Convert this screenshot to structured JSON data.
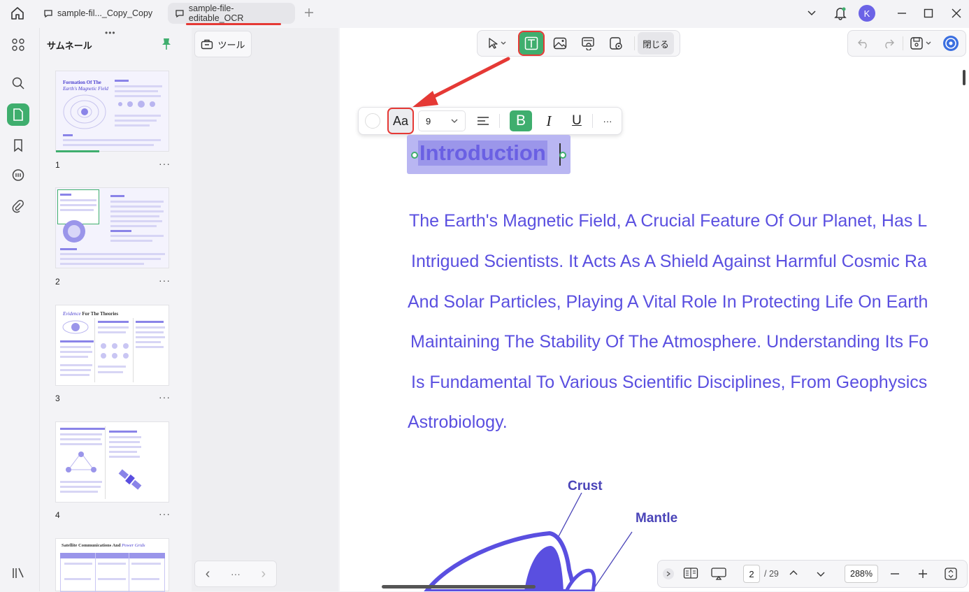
{
  "tabs": [
    {
      "label": "sample-fil..._Copy_Copy"
    },
    {
      "label": "sample-file-editable_OCR"
    }
  ],
  "user": {
    "initial": "K"
  },
  "thumbnails": {
    "title": "サムネール",
    "pages": [
      "1",
      "2",
      "3",
      "4"
    ],
    "more": "···"
  },
  "thumb_text": {
    "p1_title_a": "Formation Of The",
    "p1_title_b": "Earth's Magnetic Field",
    "p3_title_a": "Evidence",
    "p3_title_b": "For The Theories",
    "p5_title_a": "Satellite Communications And",
    "p5_title_b": "Power Grids"
  },
  "tools": {
    "label": "ツール"
  },
  "edit_toolbar": {
    "close_label": "閉じる"
  },
  "format_toolbar": {
    "font_label": "Aa",
    "font_size": "9",
    "bold": "B",
    "italic": "I",
    "underline": "U",
    "more": "···"
  },
  "document": {
    "heading": "Introduction",
    "lines": [
      "The Earth's Magnetic Field, A Crucial Feature Of Our Planet, Has L",
      "Intrigued Scientists. It Acts As A Shield Against Harmful Cosmic Ra",
      "And Solar Particles, Playing A Vital Role In Protecting Life On Earth",
      "Maintaining The Stability Of The Atmosphere. Understanding Its Fo",
      "Is Fundamental To Various Scientific Disciplines, From Geophysics",
      "Astrobiology."
    ],
    "diagram_labels": {
      "crust": "Crust",
      "mantle": "Mantle"
    }
  },
  "navigation": {
    "prev": "‹",
    "dots": "···",
    "next": "›"
  },
  "pager": {
    "current": "2",
    "total": "/ 29",
    "zoom": "288%"
  },
  "colors": {
    "accent_green": "#3fae6e",
    "doc_text": "#5a4fe0",
    "highlight_red": "#e53935"
  }
}
